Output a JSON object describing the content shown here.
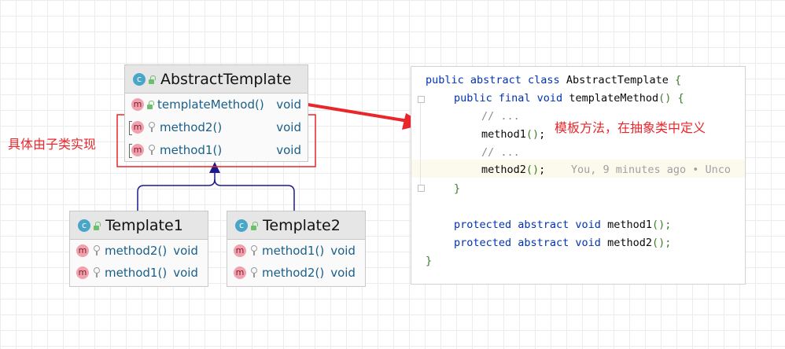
{
  "colors": {
    "accent_red": "#e8262b",
    "arrow_blue": "#1a1a8c",
    "method_blue": "#1a5f8a"
  },
  "abstract_class": {
    "icon": "class-icon",
    "name": "AbstractTemplate",
    "methods": [
      {
        "name": "templateMethod()",
        "type": "void",
        "icon": "method-icon"
      },
      {
        "name": "method2()",
        "type": "void",
        "icon": "abstract-method-icon"
      },
      {
        "name": "method1()",
        "type": "void",
        "icon": "abstract-method-icon"
      }
    ]
  },
  "template1": {
    "name": "Template1",
    "methods": [
      {
        "name": "method2()",
        "type": "void"
      },
      {
        "name": "method1()",
        "type": "void"
      }
    ]
  },
  "template2": {
    "name": "Template2",
    "methods": [
      {
        "name": "method1()",
        "type": "void"
      },
      {
        "name": "method2()",
        "type": "void"
      }
    ]
  },
  "annotations": {
    "left_label": "具体由子类实现",
    "right_label": "模板方法，在抽象类中定义"
  },
  "code": {
    "line1_kw": "public abstract class",
    "line1_name": "AbstractTemplate",
    "line1_brace": "{",
    "line2_kw": "public final void",
    "line2_name": "templateMethod",
    "line2_paren": "()",
    "line2_brace": "{",
    "line3": "// ...",
    "line4_name": "method1",
    "line4_paren": "()",
    "line4_semi": ";",
    "line5": "// ...",
    "line6_name": "method2",
    "line6_paren": "()",
    "line6_semi": ";",
    "line6_blame": "You, 9 minutes ago • Unco",
    "line7": "}",
    "line9_kw": "protected abstract void",
    "line9_name": "method1",
    "line9_rest": "();",
    "line10_kw": "protected abstract void",
    "line10_name": "method2",
    "line10_rest": "();",
    "line11": "}"
  },
  "icons": {
    "class_letter": "c",
    "method_letter": "m"
  }
}
